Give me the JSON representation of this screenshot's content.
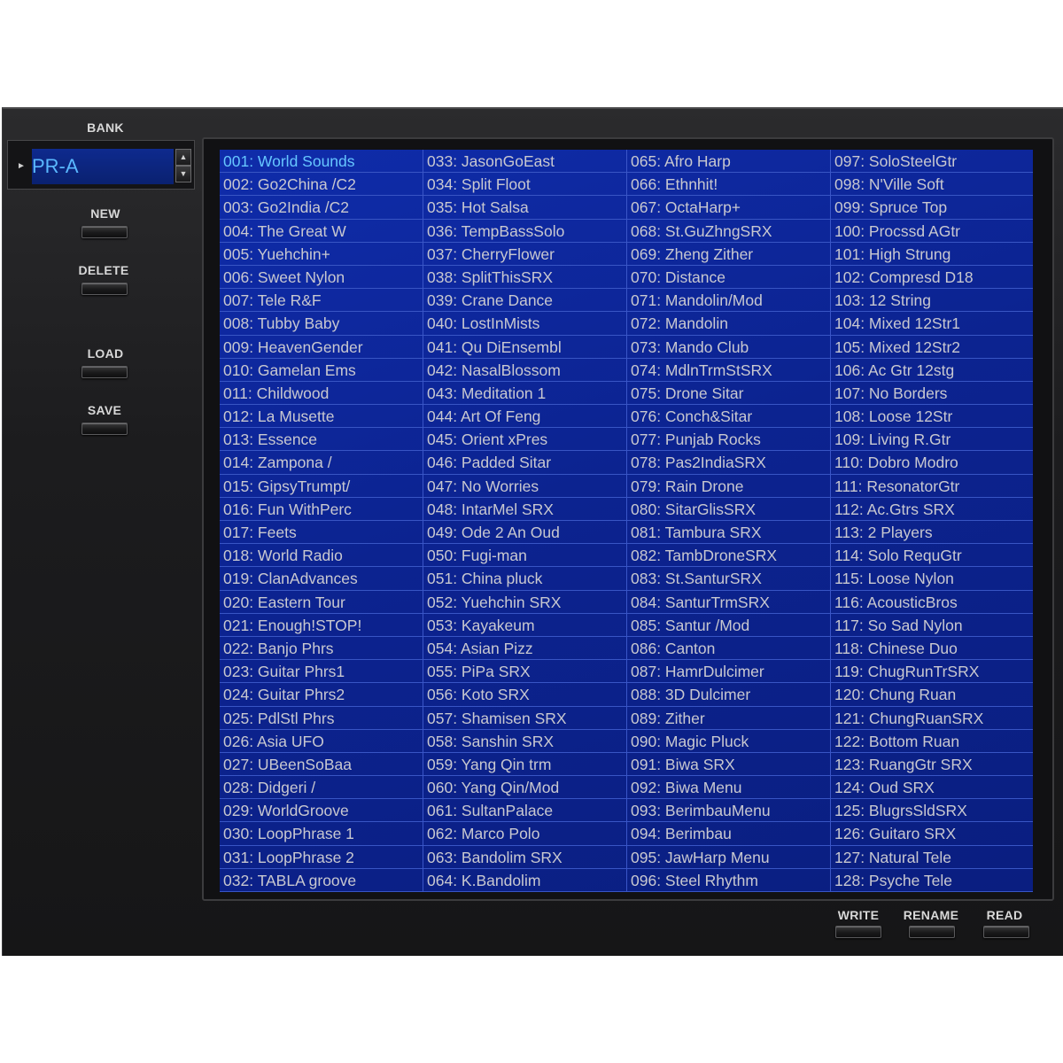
{
  "bank": {
    "label": "BANK",
    "value": "PR-A"
  },
  "side_buttons": {
    "new": "NEW",
    "delete": "DELETE",
    "load": "LOAD",
    "save": "SAVE"
  },
  "bottom_buttons": {
    "write": "WRITE",
    "rename": "RENAME",
    "read": "READ"
  },
  "selected_patch": "001: World Sounds",
  "colors": {
    "display_bg": "#0c2390",
    "selected_text": "#66c6ff",
    "text": "#c8c8d0",
    "panel": "#1c1c1e"
  },
  "patches": [
    [
      "001: World Sounds",
      "002: Go2China /C2",
      "003: Go2India /C2",
      "004: The Great W",
      "005: Yuehchin+",
      "006: Sweet Nylon",
      "007: Tele R&F",
      "008: Tubby Baby",
      "009: HeavenGender",
      "010: Gamelan Ems",
      "011: Childwood",
      "012: La Musette",
      "013: Essence",
      "014: Zampona /",
      "015: GipsyTrumpt/",
      "016: Fun WithPerc",
      "017: Feets",
      "018: World Radio",
      "019: ClanAdvances",
      "020: Eastern Tour",
      "021: Enough!STOP!",
      "022: Banjo Phrs",
      "023: Guitar Phrs1",
      "024: Guitar Phrs2",
      "025: PdlStl Phrs",
      "026: Asia  UFO",
      "027: UBeenSoBaa",
      "028: Didgeri /",
      "029: WorldGroove",
      "030: LoopPhrase 1",
      "031: LoopPhrase 2",
      "032: TABLA groove"
    ],
    [
      "033: JasonGoEast",
      "034: Split Floot",
      "035: Hot Salsa",
      "036: TempBassSolo",
      "037: CherryFlower",
      "038: SplitThisSRX",
      "039: Crane Dance",
      "040: LostInMists",
      "041: Qu DiEnsembl",
      "042: NasalBlossom",
      "043: Meditation 1",
      "044: Art Of Feng",
      "045: Orient xPres",
      "046: Padded Sitar",
      "047: No Worries",
      "048: IntarMel SRX",
      "049: Ode 2 An Oud",
      "050: Fugi-man",
      "051: China pluck",
      "052: Yuehchin SRX",
      "053: Kayakeum",
      "054: Asian Pizz",
      "055: PiPa SRX",
      "056: Koto SRX",
      "057: Shamisen SRX",
      "058: Sanshin SRX",
      "059: Yang Qin trm",
      "060: Yang Qin/Mod",
      "061: SultanPalace",
      "062: Marco Polo",
      "063: Bandolim SRX",
      "064: K.Bandolim"
    ],
    [
      "065: Afro Harp",
      "066: Ethnhit!",
      "067: OctaHarp+",
      "068: St.GuZhngSRX",
      "069: Zheng Zither",
      "070: Distance",
      "071: Mandolin/Mod",
      "072: Mandolin",
      "073: Mando Club",
      "074: MdlnTrmStSRX",
      "075: Drone Sitar",
      "076: Conch&Sitar",
      "077: Punjab Rocks",
      "078: Pas2IndiaSRX",
      "079: Rain Drone",
      "080: SitarGlisSRX",
      "081: Tambura SRX",
      "082: TambDroneSRX",
      "083: St.SanturSRX",
      "084: SanturTrmSRX",
      "085: Santur /Mod",
      "086: Canton",
      "087: HamrDulcimer",
      "088: 3D Dulcimer",
      "089: Zither",
      "090: Magic Pluck",
      "091: Biwa SRX",
      "092: Biwa Menu",
      "093: BerimbauMenu",
      "094: Berimbau",
      "095: JawHarp Menu",
      "096: Steel Rhythm"
    ],
    [
      "097: SoloSteelGtr",
      "098: N'Ville Soft",
      "099: Spruce Top",
      "100: Procssd AGtr",
      "101: High Strung",
      "102: Compresd D18",
      "103: 12 String",
      "104: Mixed 12Str1",
      "105: Mixed 12Str2",
      "106: Ac Gtr 12stg",
      "107: No Borders",
      "108: Loose 12Str",
      "109: Living R.Gtr",
      "110: Dobro Modro",
      "111: ResonatorGtr",
      "112: Ac.Gtrs SRX",
      "113: 2 Players",
      "114: Solo RequGtr",
      "115: Loose Nylon",
      "116: AcousticBros",
      "117: So Sad Nylon",
      "118: Chinese Duo",
      "119: ChugRunTrSRX",
      "120: Chung Ruan",
      "121: ChungRuanSRX",
      "122: Bottom Ruan",
      "123: RuangGtr SRX",
      "124: Oud SRX",
      "125: BlugrsSldSRX",
      "126: Guitaro SRX",
      "127: Natural Tele",
      "128: Psyche Tele"
    ]
  ]
}
